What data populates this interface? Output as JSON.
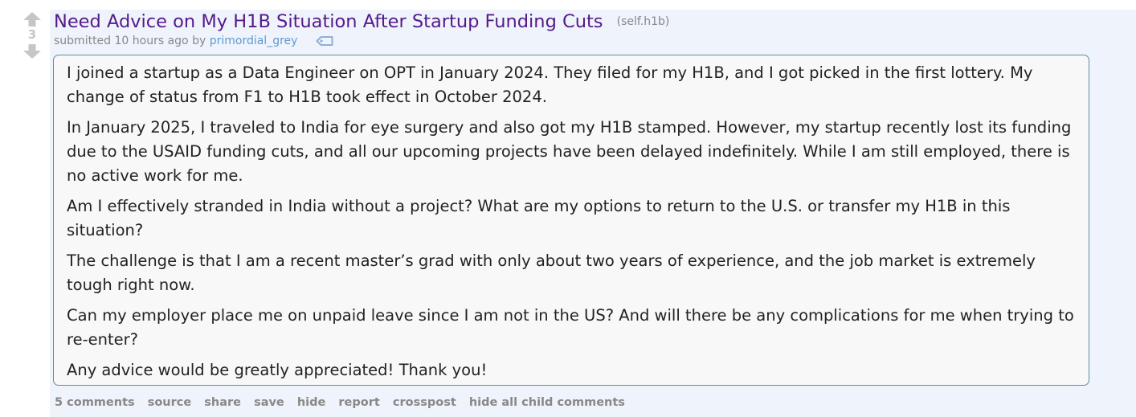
{
  "vote": {
    "score": "3",
    "upvote_icon": "up-arrow",
    "downvote_icon": "down-arrow",
    "arrow_color": "#c6c6c6"
  },
  "post": {
    "title": "Need Advice on My H1B Situation After Startup Funding Cuts",
    "domain": "(self.h1b)",
    "submitted_text": "submitted 10 hours ago by",
    "author": "primordial_grey",
    "tag_icon": "tag-icon",
    "paragraphs": [
      "I joined a startup as a Data Engineer on OPT in January 2024. They filed for my H1B, and I got picked in the first lottery. My change of status from F1 to H1B took effect in October 2024.",
      "In January 2025, I traveled to India for eye surgery and also got my H1B stamped. However, my startup recently lost its funding due to the USAID funding cuts, and all our upcoming projects have been delayed indefinitely. While I am still employed, there is no active work for me.",
      "Am I effectively stranded in India without a project? What are my options to return to the U.S. or transfer my H1B in this situation?",
      "The challenge is that I am a recent master’s grad with only about two years of experience, and the job market is extremely tough right now.",
      "Can my employer place me on unpaid leave since I am not in the US? And will there be any complications for me when trying to re-enter?",
      "Any advice would be greatly appreciated! Thank you!"
    ]
  },
  "actions": {
    "comments": "5 comments",
    "source": "source",
    "share": "share",
    "save": "save",
    "hide": "hide",
    "report": "report",
    "crosspost": "crosspost",
    "hide_children": "hide all child comments"
  },
  "colors": {
    "title": "#551a8b",
    "author": "#5f99cf",
    "entry_bg": "#eff3fb",
    "body_border": "#5c8da1",
    "muted": "#888888"
  }
}
